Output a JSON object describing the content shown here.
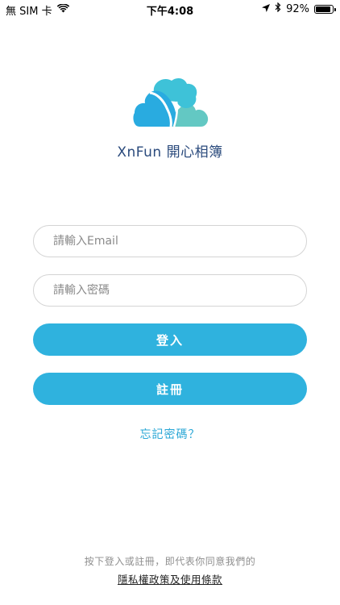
{
  "status_bar": {
    "carrier": "無 SIM 卡",
    "time": "下午4:08",
    "battery_percent": "92%",
    "battery_level": 0.92,
    "icons": [
      "wifi-icon",
      "location-arrow-icon",
      "bluetooth-icon",
      "battery-icon"
    ]
  },
  "logo": {
    "icon": "cloud-logo-icon",
    "colors": {
      "dark": "#29abe0",
      "mid": "#3ec2d8",
      "light": "#63c8c3"
    }
  },
  "app_name": "XnFun 開心相簿",
  "form": {
    "email_placeholder": "請輸入Email",
    "password_placeholder": "請輸入密碼",
    "email_value": "",
    "password_value": ""
  },
  "buttons": {
    "login_label": "登入",
    "register_label": "註冊"
  },
  "forgot_password": "忘記密碼？",
  "footer": {
    "agreement": "按下登入或註冊，即代表你同意我們的",
    "privacy_policy_link": "隱私權政策及使用條款"
  },
  "colors": {
    "accent": "#2fb2de",
    "link": "#2aa7d6",
    "title": "#2a4a7c"
  }
}
